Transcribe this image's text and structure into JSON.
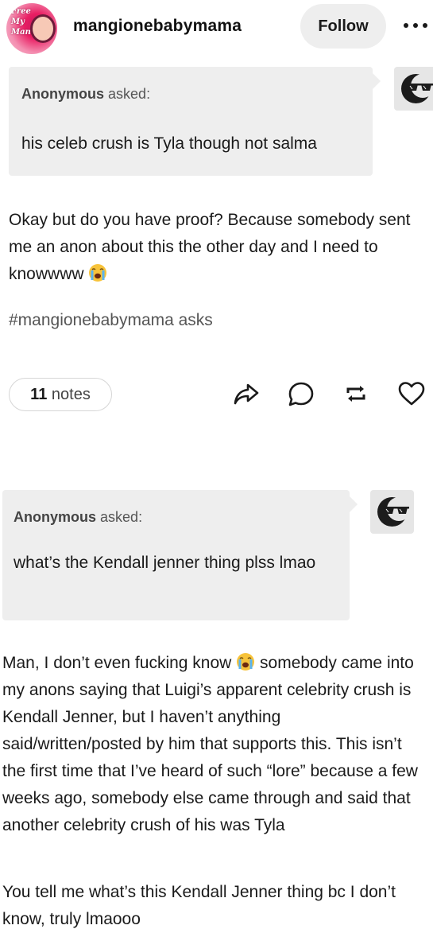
{
  "header": {
    "avatar_text": "Free My Man",
    "blog_name": "mangionebabymama",
    "follow_label": "Follow",
    "more_icon": "more-horizontal-icon"
  },
  "post1": {
    "ask": {
      "asker_name": "Anonymous",
      "asked_label": "asked:",
      "question": "his celeb crush is Tyla though not salma"
    },
    "answer_text": "Okay but do you have proof? Because somebody sent me an anon about this the other day and I need to knowwww",
    "tag": "#mangionebabymama asks",
    "notes_count": "11",
    "notes_label": "notes",
    "icons": [
      "share-icon",
      "reply-icon",
      "reblog-icon",
      "like-icon"
    ]
  },
  "post2": {
    "ask": {
      "asker_name": "Anonymous",
      "asked_label": "asked:",
      "question": "what’s the Kendall jenner thing plss lmao"
    },
    "answer_lead": "Man, I don’t even fucking know",
    "answer_rest": "somebody came into my anons saying that Luigi’s apparent celebrity crush is Kendall Jenner, but I haven’t anything said/written/posted by him that supports this. This isn’t the first time that I’ve heard of such “lore” because a few weeks ago, somebody else came through and said that another celebrity crush of his was Tyla",
    "answer_second": "You tell me what’s this Kendall Jenner thing bc I don’t know, truly lmaooo"
  },
  "colors": {
    "ask_background": "#eeeeee",
    "follow_background": "#eeeeee",
    "text": "#1a1a1a",
    "muted": "#555555"
  }
}
